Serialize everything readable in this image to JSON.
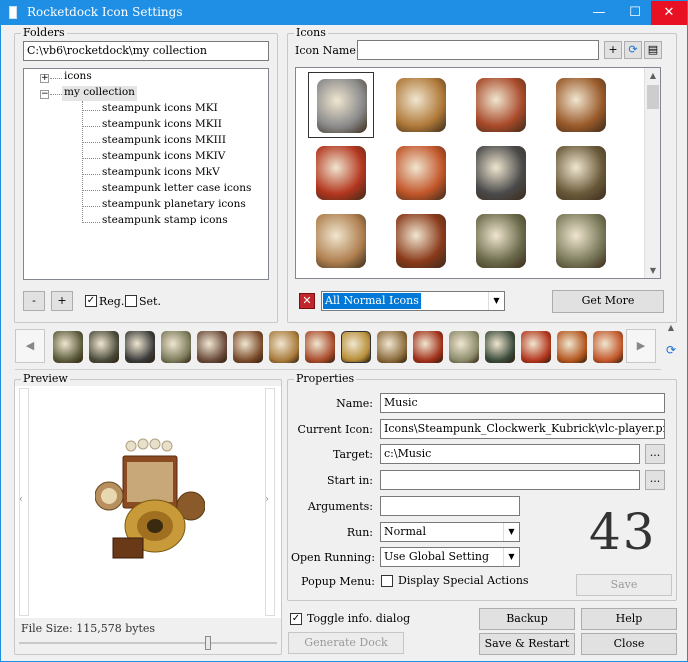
{
  "window": {
    "title": "Rocketdock Icon Settings",
    "min_glyph": "—",
    "max_glyph": "☐",
    "close_glyph": "✕"
  },
  "folders": {
    "group_label": "Folders",
    "path": "C:\\vb6\\rocketdock\\my collection",
    "tree": [
      {
        "label": "icons",
        "expander": "+"
      },
      {
        "label": "my collection",
        "expander": "−"
      },
      {
        "label": "steampunk icons MKI"
      },
      {
        "label": "steampunk icons MKII"
      },
      {
        "label": "steampunk icons MKIII"
      },
      {
        "label": "steampunk icons MKIV"
      },
      {
        "label": "steampunk icons MkV"
      },
      {
        "label": "steampunk letter case icons"
      },
      {
        "label": "steampunk planetary icons"
      },
      {
        "label": "steampunk stamp icons"
      }
    ],
    "minus_label": "-",
    "plus_label": "+",
    "reg_label": "Reg.",
    "reg_checked": "✓",
    "set_label": "Set."
  },
  "icons": {
    "group_label": "Icons",
    "name_label": "Icon Name:",
    "name_value": "",
    "add_label": "+",
    "filter_value": "All Normal Icons",
    "get_more_label": "Get More",
    "thumbnails": [
      {
        "name": "gear-eye-icon",
        "color": "#8a8a8a"
      },
      {
        "name": "syringe-icon",
        "color": "#b07a3a"
      },
      {
        "name": "metronome-icon",
        "color": "#a84a2a"
      },
      {
        "name": "globe-stand-icon",
        "color": "#9a5a2a"
      },
      {
        "name": "eye-red-icon",
        "color": "#b3361e"
      },
      {
        "name": "orb-icon",
        "color": "#c2562a"
      },
      {
        "name": "typewriter-icon",
        "color": "#4a4a4a"
      },
      {
        "name": "typewriter-lamp-icon",
        "color": "#6a5a3a"
      },
      {
        "name": "clock-bulb-icon",
        "color": "#b08050"
      },
      {
        "name": "organ-icon",
        "color": "#8a3a1a"
      },
      {
        "name": "postage-stamp-icon",
        "color": "#6a6a4a"
      },
      {
        "name": "stamp-magnifier-icon",
        "color": "#7a7a5a"
      }
    ]
  },
  "dock": {
    "left_arrow": "◀",
    "right_arrow": "▶",
    "icons": [
      {
        "name": "lamp-icon",
        "color": "#5a5a3a"
      },
      {
        "name": "typewriter-icon",
        "color": "#4a4a3a"
      },
      {
        "name": "camera-icon",
        "color": "#3a3a3a"
      },
      {
        "name": "stamp-icon",
        "color": "#7a7a5a"
      },
      {
        "name": "machine-icon",
        "color": "#6a4a3a"
      },
      {
        "name": "cabinet-icon",
        "color": "#7a4a2a"
      },
      {
        "name": "gramophone-icon",
        "color": "#a87a3a"
      },
      {
        "name": "metronome-icon",
        "color": "#a84a2a"
      },
      {
        "name": "gramophone-selected-icon",
        "color": "#b8903a"
      },
      {
        "name": "globe-icon",
        "color": "#8a6a3a"
      },
      {
        "name": "mirror-icon",
        "color": "#a0301a"
      },
      {
        "name": "valve-icon",
        "color": "#8a8a6a"
      },
      {
        "name": "safe-icon",
        "color": "#3a4a3a"
      },
      {
        "name": "lantern-icon",
        "color": "#b3361e"
      },
      {
        "name": "medal-icon",
        "color": "#b3561e"
      },
      {
        "name": "orb-icon",
        "color": "#c2562a"
      }
    ]
  },
  "preview": {
    "group_label": "Preview",
    "file_size": "File Size: 115,578 bytes",
    "left_arrow": "‹",
    "right_arrow": "›"
  },
  "properties": {
    "group_label": "Properties",
    "name_label": "Name:",
    "name_value": "Music",
    "current_icon_label": "Current Icon:",
    "current_icon_value": "Icons\\Steampunk_Clockwerk_Kubrick\\vlc-player.png",
    "target_label": "Target:",
    "target_value": "c:\\Music",
    "start_in_label": "Start in:",
    "start_in_value": "",
    "arguments_label": "Arguments:",
    "arguments_value": "",
    "run_label": "Run:",
    "run_value": "Normal",
    "open_running_label": "Open Running:",
    "open_running_value": "Use Global Setting",
    "popup_menu_label": "Popup Menu:",
    "popup_menu_text": "Display Special Actions",
    "browse_label": "...",
    "save_label": "Save",
    "count": "43"
  },
  "bottom": {
    "toggle_label": "Toggle info. dialog",
    "toggle_checked": "✓",
    "generate_label": "Generate Dock",
    "backup_label": "Backup",
    "help_label": "Help",
    "save_restart_label": "Save & Restart",
    "close_label": "Close"
  },
  "colors": {
    "titlebar": "#1f8fe6",
    "close_hover": "#e81123",
    "selection": "#0078d7"
  }
}
